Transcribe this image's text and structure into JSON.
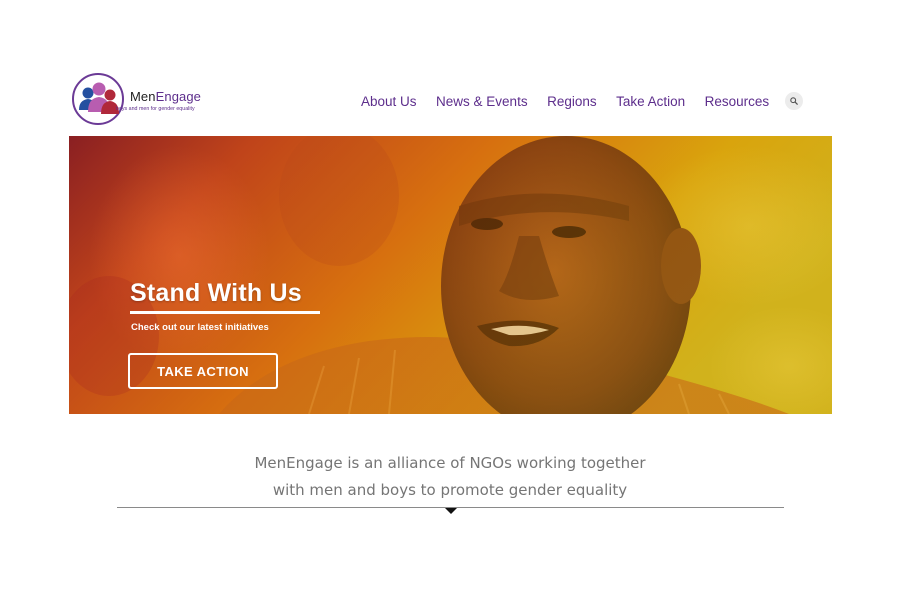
{
  "logo": {
    "name_part1": "Men",
    "name_part2": "Engage",
    "tagline": "boys and men for gender equality"
  },
  "nav": {
    "items": [
      {
        "label": "About Us"
      },
      {
        "label": "News & Events"
      },
      {
        "label": "Regions"
      },
      {
        "label": "Take Action"
      },
      {
        "label": "Resources"
      }
    ],
    "search_icon": "search-icon"
  },
  "hero": {
    "title": "Stand With Us",
    "subtitle": "Check out our latest initiatives",
    "cta_label": "TAKE ACTION"
  },
  "intro": {
    "line1": "MenEngage is an alliance of NGOs working together",
    "line2": "with men and boys to promote gender equality"
  },
  "colors": {
    "brand_purple": "#5d2e8c",
    "intro_text": "#757575",
    "hero_overlay_left": "#b0301a",
    "hero_overlay_right": "#d6b20c"
  }
}
